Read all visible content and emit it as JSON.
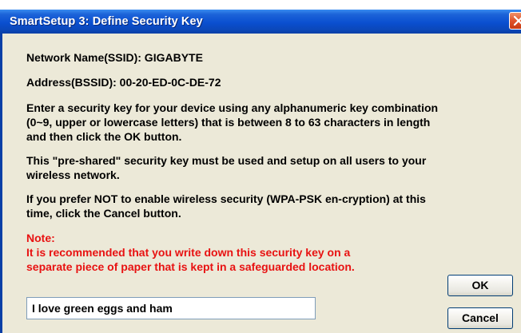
{
  "dialog": {
    "title": "SmartSetup 3: Define Security Key",
    "network_name": "Network Name(SSID):  GIGABYTE",
    "address": "Address(BSSID):  00-20-ED-0C-DE-72",
    "instructions": [
      "Enter a security key for your device using any alphanumeric key combination",
      "(0~9, upper or lowercase letters) that is between 8 to 63 characters in length",
      "and then click the OK button."
    ],
    "preshared": [
      "This \"pre-shared\" security key must be used and setup on all users to your",
      "wireless network."
    ],
    "cancel_info": [
      "If you prefer NOT to enable wireless security (WPA-PSK en-cryption) at this",
      "time, click the Cancel button."
    ],
    "note_label": "Note:",
    "note_lines": [
      "It is recommended that you write down this security key on a",
      "separate piece of paper that is kept in a safeguarded location."
    ],
    "key_value": "I love green eggs and ham",
    "ok_label": "OK",
    "cancel_label": "Cancel"
  },
  "colors": {
    "titlebar": "#0a4fd0",
    "window_bg": "#ece9d8",
    "note_text": "#e81212",
    "close_button": "#e0532a"
  }
}
